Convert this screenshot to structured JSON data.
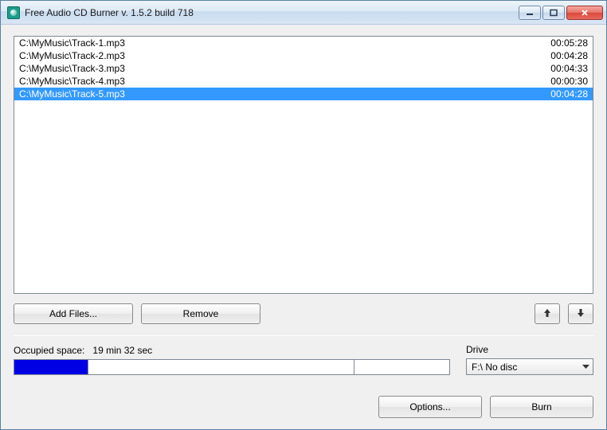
{
  "window": {
    "title": "Free Audio CD Burner  v. 1.5.2 build 718"
  },
  "files": [
    {
      "path": "C:\\MyMusic\\Track-1.mp3",
      "duration": "00:05:28",
      "selected": false
    },
    {
      "path": "C:\\MyMusic\\Track-2.mp3",
      "duration": "00:04:28",
      "selected": false
    },
    {
      "path": "C:\\MyMusic\\Track-3.mp3",
      "duration": "00:04:33",
      "selected": false
    },
    {
      "path": "C:\\MyMusic\\Track-4.mp3",
      "duration": "00:00:30",
      "selected": false
    },
    {
      "path": "C:\\MyMusic\\Track-5.mp3",
      "duration": "00:04:28",
      "selected": true
    }
  ],
  "buttons": {
    "add_files": "Add Files...",
    "remove": "Remove",
    "options": "Options...",
    "burn": "Burn"
  },
  "occupied": {
    "label": "Occupied space:",
    "value": "19 min 32 sec",
    "fill_percent": 17,
    "tick_percent": 78
  },
  "drive": {
    "label": "Drive",
    "value": "F:\\ No disc"
  }
}
